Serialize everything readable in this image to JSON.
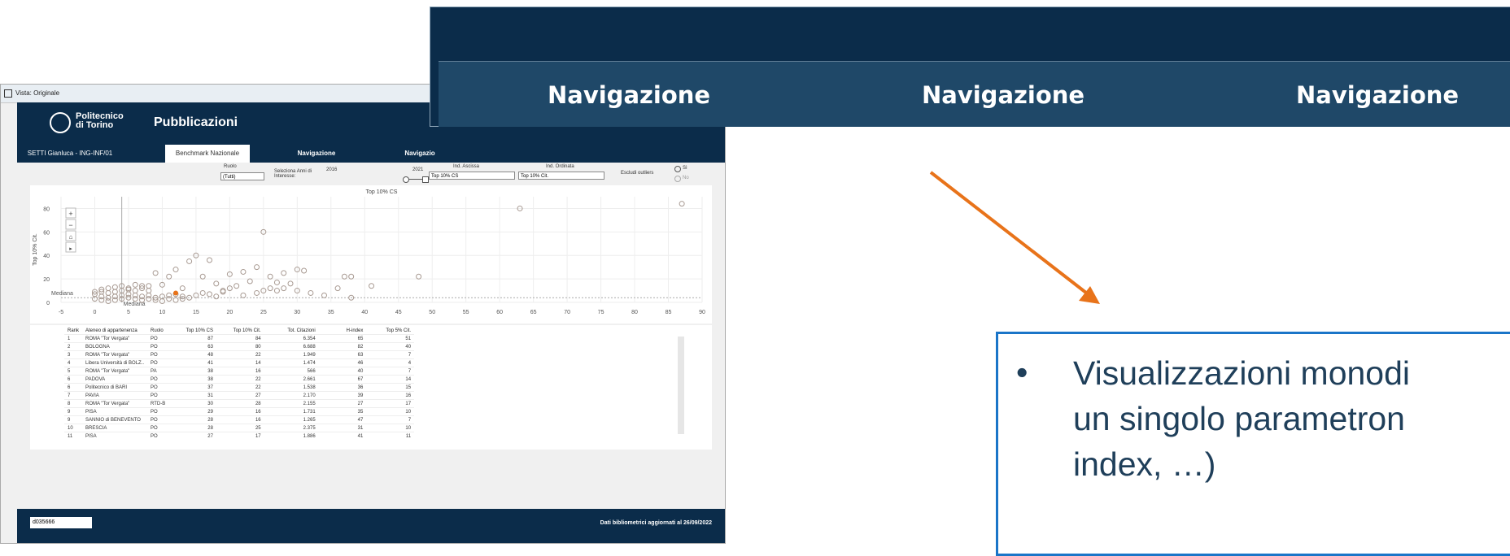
{
  "vista_label": "Vista: Originale",
  "header": {
    "logo_line1": "Politecnico",
    "logo_line2": "di Torino",
    "title": "Pubblicazioni"
  },
  "tabs": [
    {
      "label": "SETTI Gianluca - ING-INF/01"
    },
    {
      "label": "Benchmark Nazionale"
    },
    {
      "label": "Navigazione"
    },
    {
      "label": "Navigazio"
    }
  ],
  "filters": {
    "ruolo_label": "Ruolo",
    "ruolo_value": "(Tutti)",
    "anni_label": "Seleziona Anni di Interesse:",
    "year_start": "2016",
    "year_end": "2021",
    "ascissa_label": "Ind. Ascissa",
    "ascissa_value": "Top 10% CS",
    "ordinata_label": "Ind. Ordinata",
    "ordinata_value": "Top 10% Cit.",
    "outlier_label": "Escludi outliers",
    "opt_si": "Sì",
    "opt_no": "No"
  },
  "chart_data": {
    "type": "scatter",
    "title": "Top 10% CS",
    "xlabel": "",
    "ylabel": "Top 10% Cit.",
    "xlim": [
      -5,
      90
    ],
    "ylim": [
      0,
      90
    ],
    "xticks": [
      "-5",
      "0",
      "5",
      "10",
      "15",
      "20",
      "25",
      "30",
      "35",
      "40",
      "45",
      "50",
      "55",
      "60",
      "65",
      "70",
      "75",
      "80",
      "85",
      "90"
    ],
    "yticks": [
      "0",
      "20",
      "40",
      "60",
      "80"
    ],
    "median_label": "Mediana",
    "grid": true,
    "points": [
      [
        87,
        84
      ],
      [
        63,
        80
      ],
      [
        25,
        60
      ],
      [
        48,
        22
      ],
      [
        41,
        14
      ],
      [
        38,
        22
      ],
      [
        37,
        22
      ],
      [
        31,
        27
      ],
      [
        30,
        28
      ],
      [
        29,
        16
      ],
      [
        28,
        25
      ],
      [
        27,
        17
      ],
      [
        15,
        40
      ],
      [
        14,
        35
      ],
      [
        17,
        36
      ],
      [
        11,
        22
      ],
      [
        9,
        25
      ],
      [
        12,
        28
      ],
      [
        16,
        22
      ],
      [
        20,
        24
      ],
      [
        22,
        26
      ],
      [
        24,
        30
      ],
      [
        26,
        22
      ],
      [
        23,
        18
      ],
      [
        21,
        14
      ],
      [
        18,
        16
      ],
      [
        19,
        10
      ],
      [
        13,
        12
      ],
      [
        10,
        15
      ],
      [
        8,
        14
      ],
      [
        7,
        12
      ],
      [
        6,
        10
      ],
      [
        5,
        12
      ],
      [
        4,
        10
      ],
      [
        3,
        9
      ],
      [
        2,
        8
      ],
      [
        1,
        9
      ],
      [
        0,
        7
      ],
      [
        1,
        5
      ],
      [
        2,
        4
      ],
      [
        3,
        5
      ],
      [
        4,
        6
      ],
      [
        5,
        7
      ],
      [
        6,
        6
      ],
      [
        7,
        5
      ],
      [
        8,
        6
      ],
      [
        9,
        4
      ],
      [
        10,
        5
      ],
      [
        11,
        6
      ],
      [
        12,
        7
      ],
      [
        13,
        5
      ],
      [
        14,
        4
      ],
      [
        15,
        6
      ],
      [
        16,
        8
      ],
      [
        17,
        7
      ],
      [
        18,
        5
      ],
      [
        19,
        9
      ],
      [
        20,
        12
      ],
      [
        22,
        6
      ],
      [
        24,
        8
      ],
      [
        25,
        10
      ],
      [
        26,
        12
      ],
      [
        27,
        10
      ],
      [
        28,
        12
      ],
      [
        30,
        10
      ],
      [
        32,
        8
      ],
      [
        34,
        6
      ],
      [
        36,
        12
      ],
      [
        38,
        4
      ],
      [
        0,
        3
      ],
      [
        1,
        2
      ],
      [
        2,
        1
      ],
      [
        3,
        2
      ],
      [
        4,
        3
      ],
      [
        5,
        4
      ],
      [
        6,
        3
      ],
      [
        7,
        2
      ],
      [
        8,
        3
      ],
      [
        9,
        2
      ],
      [
        10,
        1
      ],
      [
        11,
        3
      ],
      [
        12,
        2
      ],
      [
        13,
        3
      ],
      [
        0,
        9
      ],
      [
        1,
        11
      ],
      [
        2,
        12
      ],
      [
        3,
        13
      ],
      [
        4,
        14
      ],
      [
        5,
        11
      ],
      [
        6,
        15
      ],
      [
        7,
        14
      ],
      [
        8,
        10
      ]
    ],
    "highlight": [
      12,
      8
    ]
  },
  "table": {
    "headers": [
      "Rank",
      "Ateneo di appartenenza",
      "Ruolo",
      "Top 10% CS",
      "Top 10% Cit.",
      "Tot. Citazioni",
      "H-index",
      "Top 5% Cit."
    ],
    "rows": [
      [
        "1",
        "ROMA \"Tor Vergata\"",
        "PO",
        "87",
        "84",
        "6.354",
        "65",
        "51"
      ],
      [
        "2",
        "BOLOGNA",
        "PO",
        "63",
        "80",
        "6.688",
        "82",
        "40"
      ],
      [
        "3",
        "ROMA \"Tor Vergata\"",
        "PO",
        "48",
        "22",
        "1.949",
        "63",
        "7"
      ],
      [
        "4",
        "Libera Università di BOLZ..",
        "PO",
        "41",
        "14",
        "1.474",
        "46",
        "4"
      ],
      [
        "5",
        "ROMA \"Tor Vergata\"",
        "PA",
        "38",
        "16",
        "566",
        "40",
        "7"
      ],
      [
        "6",
        "PADOVA",
        "PO",
        "38",
        "22",
        "2.661",
        "67",
        "14"
      ],
      [
        "6",
        "Politecnico di BARI",
        "PO",
        "37",
        "22",
        "1.538",
        "36",
        "15"
      ],
      [
        "7",
        "PAVIA",
        "PO",
        "31",
        "27",
        "2.170",
        "39",
        "16"
      ],
      [
        "8",
        "ROMA \"Tor Vergata\"",
        "RTD-B",
        "30",
        "28",
        "2.155",
        "27",
        "17"
      ],
      [
        "9",
        "PISA",
        "PO",
        "29",
        "16",
        "1.731",
        "35",
        "10"
      ],
      [
        "9",
        "SANNIO di BENEVENTO",
        "PO",
        "28",
        "16",
        "1.265",
        "47",
        "7"
      ],
      [
        "10",
        "BRESCIA",
        "PO",
        "28",
        "25",
        "2.375",
        "31",
        "10"
      ],
      [
        "11",
        "PISA",
        "PO",
        "27",
        "17",
        "1.886",
        "41",
        "11"
      ]
    ]
  },
  "footer": {
    "code": "d035666",
    "note": "Dati bibliometrici aggiornati al 26/09/2022"
  },
  "zoom_nav": [
    "Navigazione",
    "Navigazione",
    "Navigazione"
  ],
  "callout": {
    "bullet": "•",
    "text": "Visualizzazioni monodi un singolo parametron index, …)",
    "line1": "Visualizzazioni monodi",
    "line2": "un singolo parametron",
    "line3": "index, …)"
  },
  "colors": {
    "navy": "#0b2c4a",
    "arrow": "#e8731a",
    "callout_border": "#1a75c8"
  }
}
